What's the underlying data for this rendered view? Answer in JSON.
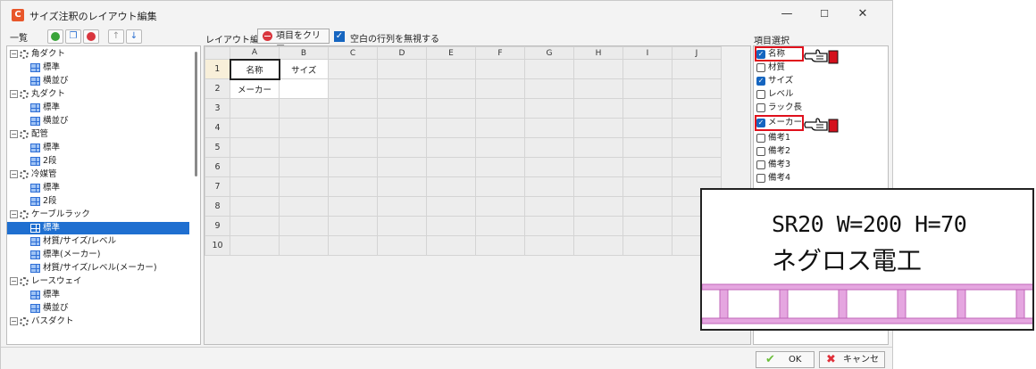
{
  "window": {
    "title": "サイズ注釈のレイアウト編集",
    "minimize": "—",
    "maximize": "☐",
    "close": "✕"
  },
  "left_panel": {
    "header": "一覧",
    "tree": [
      {
        "label": "角ダクト",
        "type": "group",
        "expanded": true
      },
      {
        "label": "標準",
        "type": "leaf"
      },
      {
        "label": "横並び",
        "type": "leaf"
      },
      {
        "label": "丸ダクト",
        "type": "group",
        "expanded": true
      },
      {
        "label": "標準",
        "type": "leaf"
      },
      {
        "label": "横並び",
        "type": "leaf"
      },
      {
        "label": "配管",
        "type": "group",
        "expanded": true
      },
      {
        "label": "標準",
        "type": "leaf"
      },
      {
        "label": "2段",
        "type": "leaf"
      },
      {
        "label": "冷媒管",
        "type": "group",
        "expanded": true
      },
      {
        "label": "標準",
        "type": "leaf"
      },
      {
        "label": "2段",
        "type": "leaf"
      },
      {
        "label": "ケーブルラック",
        "type": "group",
        "expanded": true
      },
      {
        "label": "標準",
        "type": "leaf",
        "selected": true
      },
      {
        "label": "材質/サイズ/レベル",
        "type": "leaf"
      },
      {
        "label": "標準(メーカー)",
        "type": "leaf"
      },
      {
        "label": "材質/サイズ/レベル(メーカー)",
        "type": "leaf"
      },
      {
        "label": "レースウェイ",
        "type": "group",
        "expanded": true
      },
      {
        "label": "標準",
        "type": "leaf"
      },
      {
        "label": "横並び",
        "type": "leaf"
      },
      {
        "label": "バスダクト",
        "type": "group",
        "expanded": true
      }
    ]
  },
  "layout_editor": {
    "label": "レイアウト編集",
    "clear_button": "項目をクリアー",
    "ignore_empty_label": "空白の行列を無視する",
    "ignore_empty_checked": true,
    "columns": [
      "A",
      "B",
      "C",
      "D",
      "E",
      "F",
      "G",
      "H",
      "I",
      "J"
    ],
    "rows": [
      "1",
      "2",
      "3",
      "4",
      "5",
      "6",
      "7",
      "8",
      "9",
      "10"
    ],
    "cells": {
      "r1": [
        "名称",
        "サイズ"
      ],
      "r2": [
        "メーカー",
        ""
      ]
    }
  },
  "item_select": {
    "label": "項目選択",
    "items": [
      {
        "label": "名称",
        "checked": true
      },
      {
        "label": "材質",
        "checked": false
      },
      {
        "label": "サイズ",
        "checked": true
      },
      {
        "label": "レベル",
        "checked": false
      },
      {
        "label": "ラック長",
        "checked": false
      },
      {
        "label": "メーカー",
        "checked": true
      },
      {
        "label": "備考1",
        "checked": false
      },
      {
        "label": "備考2",
        "checked": false
      },
      {
        "label": "備考3",
        "checked": false
      },
      {
        "label": "備考4",
        "checked": false
      }
    ]
  },
  "footer": {
    "ok": "OK",
    "cancel": "キャンセル"
  },
  "callout": {
    "line1": "SR20 W=200 H=70",
    "line2": "ネグロス電工"
  },
  "colors": {
    "selection": "#1f6fd0",
    "check": "#1565c0",
    "highlight_box": "#e0101c",
    "rack": "#e5a6e0"
  }
}
